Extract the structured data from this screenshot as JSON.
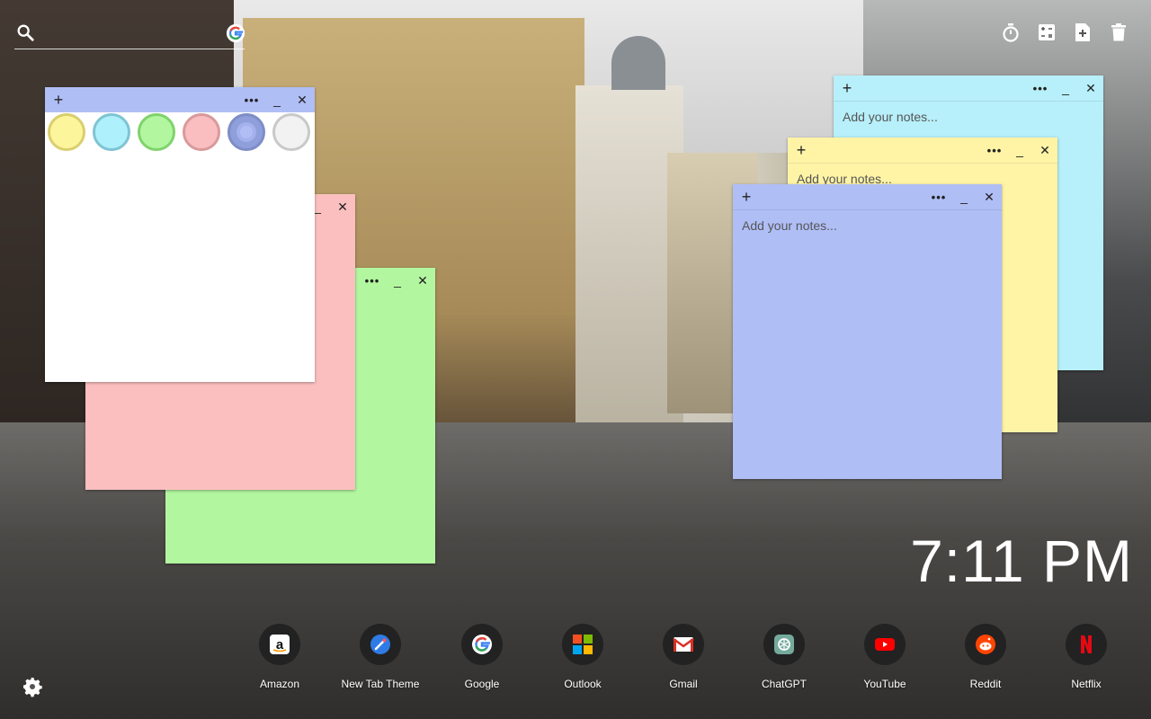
{
  "topbar": {
    "icons": [
      "search-icon",
      "google-icon",
      "timer-icon",
      "calculator-icon",
      "add-note-icon",
      "trash-icon"
    ]
  },
  "palette": {
    "swatches": [
      {
        "name": "yellow",
        "fill": "#fdf59b",
        "ring": "#d9cf6f"
      },
      {
        "name": "cyan",
        "fill": "#aef0fb",
        "ring": "#7fc4d4"
      },
      {
        "name": "green",
        "fill": "#b2f7a0",
        "ring": "#7fd36b"
      },
      {
        "name": "pink",
        "fill": "#fbbec0",
        "ring": "#d99a9c"
      },
      {
        "name": "periwinkle",
        "fill": "#b0bef5",
        "ring": "#7f8dc7",
        "selected": true
      },
      {
        "name": "white",
        "fill": "#f2f2f2",
        "ring": "#c9c9c9"
      }
    ]
  },
  "notes": [
    {
      "color": "#b0bef6",
      "placeholder": "Add your notes..."
    },
    {
      "color": "#fff4a6",
      "placeholder": "Add your notes..."
    },
    {
      "color": "#b7effa",
      "placeholder": "Add your notes..."
    },
    {
      "color": "#b2f7a0",
      "placeholder": ""
    },
    {
      "color": "#fbbfbf",
      "placeholder": ""
    },
    {
      "color": "#ffffff",
      "placeholder": ""
    }
  ],
  "note_controls": {
    "add": "+",
    "more": "•••",
    "minimize": "_",
    "close": "✕"
  },
  "clock": {
    "time": "7:11 PM"
  },
  "dock": {
    "items": [
      {
        "label": "Amazon",
        "icon": "amazon-icon"
      },
      {
        "label": "New Tab Theme",
        "icon": "new-tab-theme-icon"
      },
      {
        "label": "Google",
        "icon": "google-icon"
      },
      {
        "label": "Outlook",
        "icon": "outlook-icon"
      },
      {
        "label": "Gmail",
        "icon": "gmail-icon"
      },
      {
        "label": "ChatGPT",
        "icon": "chatgpt-icon"
      },
      {
        "label": "YouTube",
        "icon": "youtube-icon"
      },
      {
        "label": "Reddit",
        "icon": "reddit-icon"
      },
      {
        "label": "Netflix",
        "icon": "netflix-icon"
      }
    ]
  },
  "settings": {
    "icon": "gear-icon"
  }
}
